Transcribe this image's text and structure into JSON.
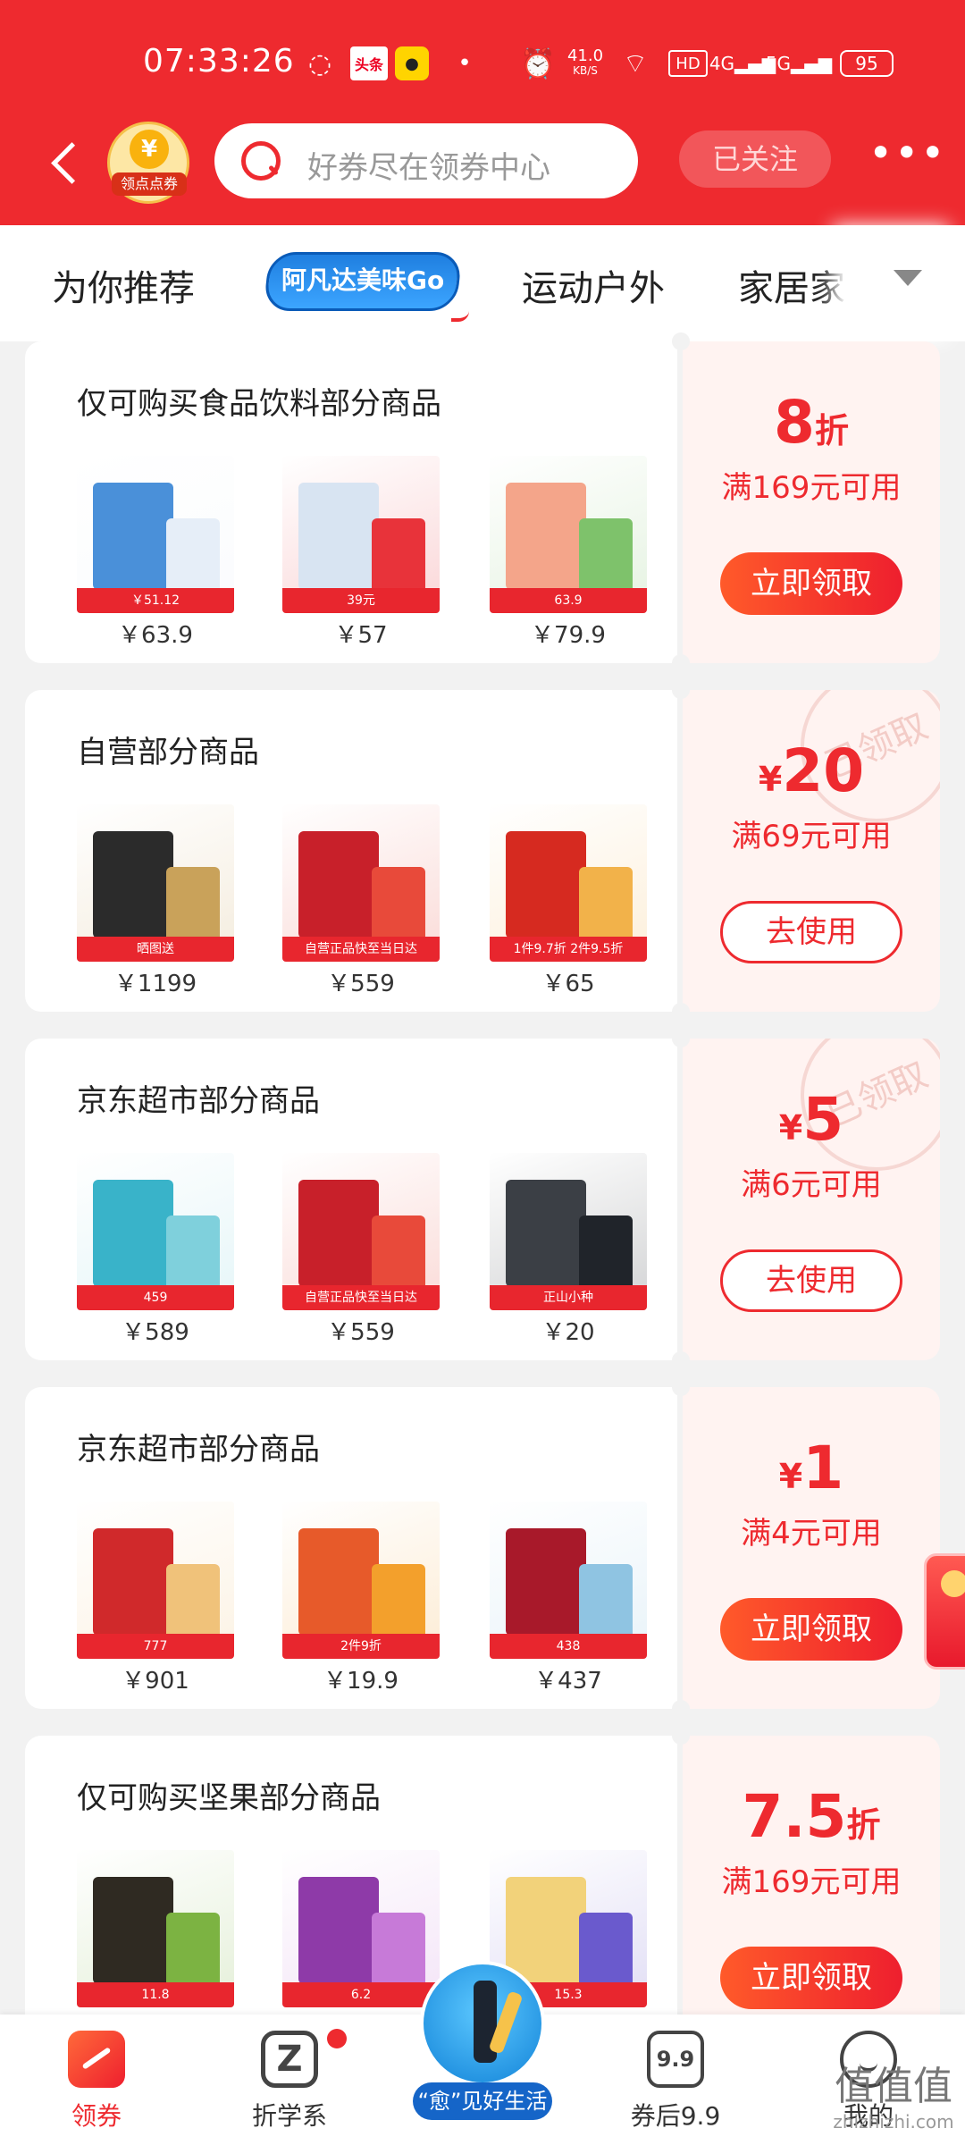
{
  "status_bar": {
    "time": "07:33:26",
    "news_label": "头条",
    "net_speed_value": "41.0",
    "net_speed_unit": "KB/S",
    "hd_label": "HD",
    "signal_4g": "4G",
    "signal_5g": "5G",
    "battery": "95"
  },
  "header": {
    "coupon_badge_label": "领点点券",
    "coin_symbol": "¥",
    "search_placeholder": "好券尽在领券中心",
    "follow_label": "已关注",
    "more_label": "•••"
  },
  "tabs": {
    "items": [
      {
        "label": "为你推荐"
      },
      {
        "label": "阿凡达美味Go"
      },
      {
        "label": "运动户外"
      },
      {
        "label": "家居家"
      }
    ],
    "active_index": 1
  },
  "coupons": [
    {
      "title": "仅可购买食品饮料部分商品",
      "discount_value": "8",
      "discount_unit": "折",
      "discount_prefix": "",
      "condition": "满169元可用",
      "action": "立即领取",
      "claimed": false,
      "products": [
        {
          "price": "￥63.9",
          "color_a": "#4a90d9",
          "color_b": "#e6eef8",
          "tag": "￥51.12"
        },
        {
          "price": "￥57",
          "color_a": "#d8e4f2",
          "color_b": "#e8333a",
          "tag": "39元"
        },
        {
          "price": "￥79.9",
          "color_a": "#f4a58a",
          "color_b": "#7ec26b",
          "tag": "63.9"
        }
      ]
    },
    {
      "title": "自营部分商品",
      "discount_value": "20",
      "discount_unit": "",
      "discount_prefix": "¥",
      "condition": "满69元可用",
      "action": "去使用",
      "claimed": true,
      "stamp": "已领取",
      "products": [
        {
          "price": "￥1199",
          "color_a": "#2b2b2b",
          "color_b": "#c9a25a",
          "tag": "晒图送"
        },
        {
          "price": "￥559",
          "color_a": "#c8202a",
          "color_b": "#e84a3a",
          "tag": "自营正品快至当日达"
        },
        {
          "price": "￥65",
          "color_a": "#d62a20",
          "color_b": "#f2b24a",
          "tag": "1件9.7折 2件9.5折"
        }
      ]
    },
    {
      "title": "京东超市部分商品",
      "discount_value": "5",
      "discount_unit": "",
      "discount_prefix": "¥",
      "condition": "满6元可用",
      "action": "去使用",
      "claimed": true,
      "stamp": "已领取",
      "products": [
        {
          "price": "￥589",
          "color_a": "#39b3c9",
          "color_b": "#7fd0dc",
          "tag": "459"
        },
        {
          "price": "￥559",
          "color_a": "#c8202a",
          "color_b": "#e84a3a",
          "tag": "自营正品快至当日达"
        },
        {
          "price": "￥20",
          "color_a": "#3b3f45",
          "color_b": "#20242a",
          "tag": "正山小种"
        }
      ]
    },
    {
      "title": "京东超市部分商品",
      "discount_value": "1",
      "discount_unit": "",
      "discount_prefix": "¥",
      "condition": "满4元可用",
      "action": "立即领取",
      "claimed": false,
      "products": [
        {
          "price": "￥901",
          "color_a": "#d0292b",
          "color_b": "#f0c27a",
          "tag": "777"
        },
        {
          "price": "￥19.9",
          "color_a": "#e75a2a",
          "color_b": "#f3a02c",
          "tag": "2件9折"
        },
        {
          "price": "￥437",
          "color_a": "#a8192a",
          "color_b": "#8fc4e2",
          "tag": "438"
        }
      ]
    },
    {
      "title": "仅可购买坚果部分商品",
      "discount_value": "7.5",
      "discount_unit": "折",
      "discount_prefix": "",
      "condition": "满169元可用",
      "action": "立即领取",
      "claimed": false,
      "products": [
        {
          "price": "",
          "color_a": "#2f2a22",
          "color_b": "#7cb342",
          "tag": "11.8"
        },
        {
          "price": "",
          "color_a": "#8e3aa8",
          "color_b": "#c77ad8",
          "tag": "6.2"
        },
        {
          "price": "",
          "color_a": "#f2d27a",
          "color_b": "#6a5acd",
          "tag": "15.3"
        }
      ]
    }
  ],
  "bottom_nav": {
    "items": [
      {
        "label": "领券",
        "icon": "coupon-icon"
      },
      {
        "label": "折学系",
        "icon": "z-icon"
      },
      {
        "label": "“愈”见好生活",
        "icon": "promo-bubble-icon"
      },
      {
        "label": "券后9.9",
        "icon": "price-99-icon",
        "icon_text": "9.9"
      },
      {
        "label": "我的",
        "icon": "profile-smile-icon"
      }
    ],
    "active_index": 0
  },
  "watermark": {
    "main": "值值值",
    "url": "zhizhizhi.com"
  },
  "colors": {
    "brand_red": "#ee2a2f",
    "avatar_blue": "#1f7fe0"
  }
}
